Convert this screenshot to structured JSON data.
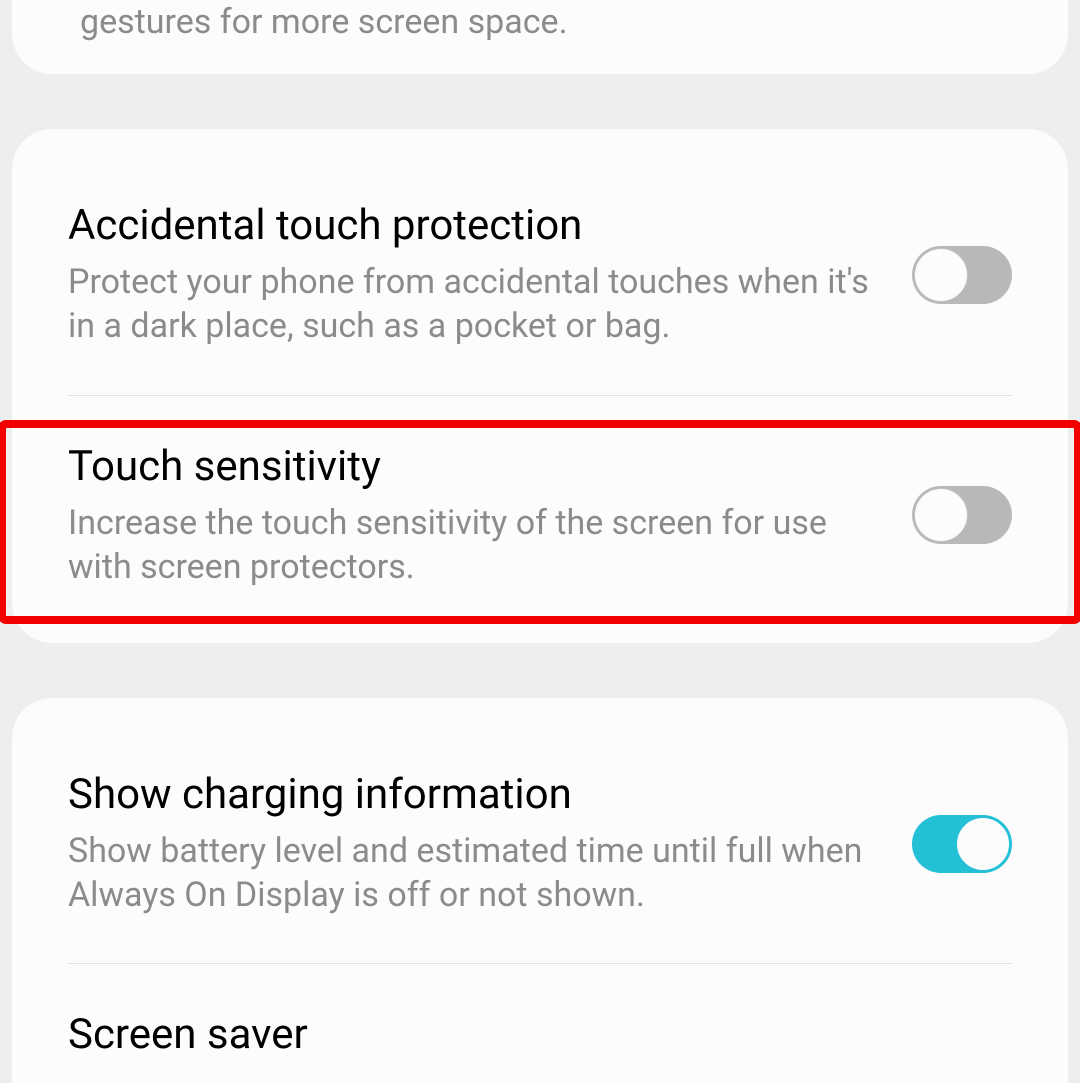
{
  "top_card": {
    "partial_text": "gestures for more screen space."
  },
  "middle_card": {
    "items": [
      {
        "title": "Accidental touch protection",
        "desc": "Protect your phone from accidental touches when it's in a dark place, such as a pocket or bag.",
        "toggle": "off"
      },
      {
        "title": "Touch sensitivity",
        "desc": "Increase the touch sensitivity of the screen for use with screen protectors.",
        "toggle": "off"
      }
    ]
  },
  "bottom_card": {
    "items": [
      {
        "title": "Show charging information",
        "desc": "Show battery level and estimated time until full when Always On Display is off or not shown.",
        "toggle": "on"
      },
      {
        "title": "Screen saver",
        "desc": "",
        "toggle": null
      }
    ]
  }
}
